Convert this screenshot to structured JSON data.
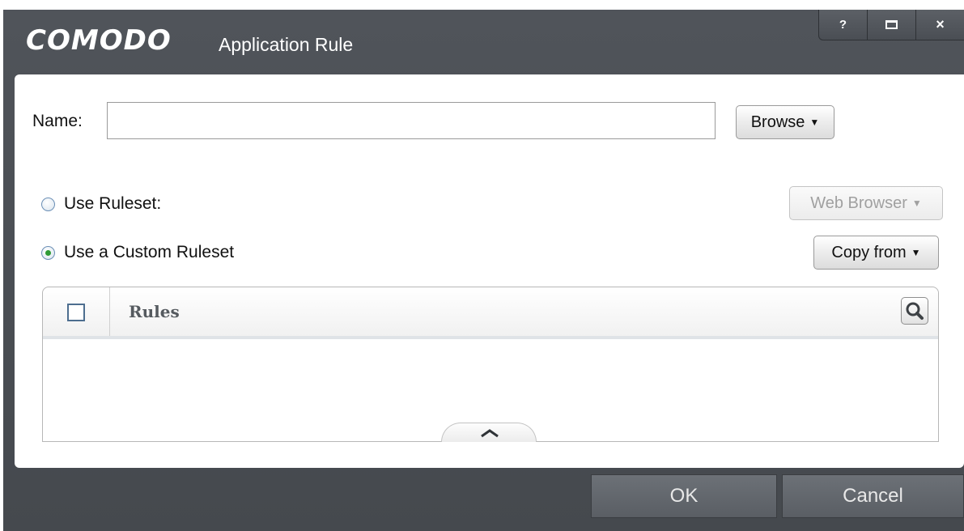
{
  "window": {
    "brand": "COMODO",
    "title": "Application Rule",
    "controls": {
      "help": "?",
      "close": "×"
    }
  },
  "form": {
    "name_label": "Name:",
    "name_value": "",
    "browse_label": "Browse",
    "use_ruleset_label": "Use Ruleset:",
    "ruleset_select": "Web Browser",
    "use_custom_label": "Use a Custom Ruleset",
    "copy_from_label": "Copy from",
    "selected_option": "custom"
  },
  "rules_table": {
    "header": "Rules",
    "rows": []
  },
  "footer": {
    "ok_label": "OK",
    "cancel_label": "Cancel"
  },
  "colors": {
    "chrome": "#4a4e54",
    "panel": "#ffffff",
    "radio_checked": "#2f9a35"
  }
}
